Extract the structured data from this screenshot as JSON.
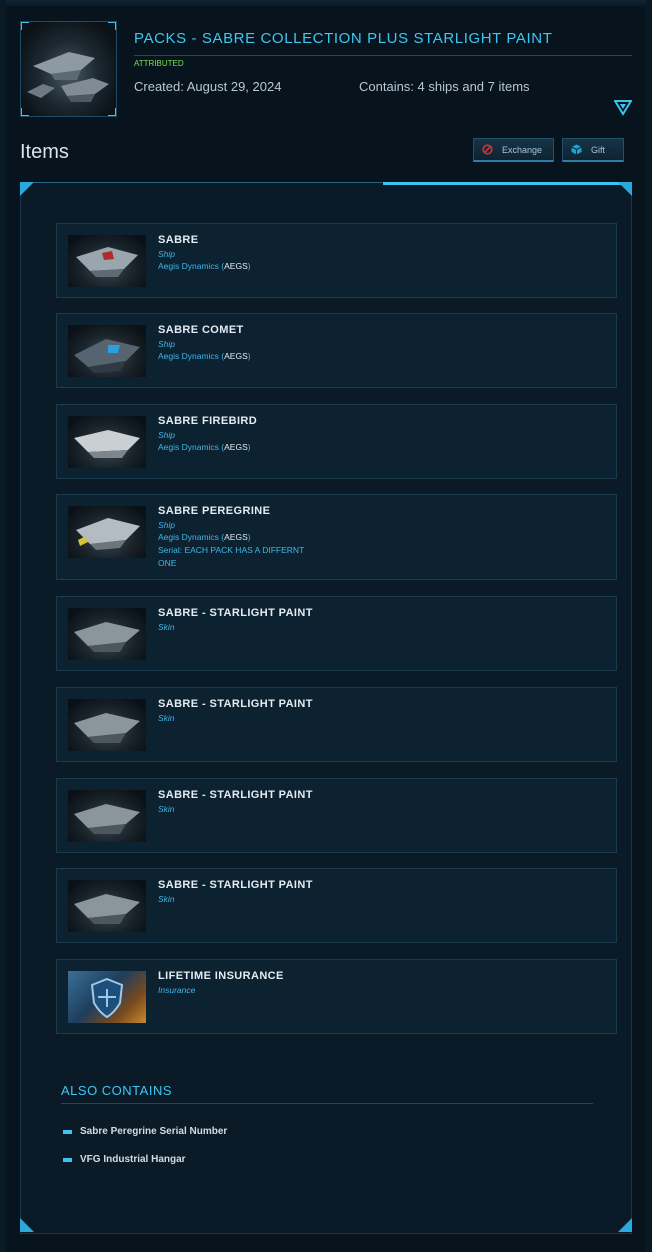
{
  "pack": {
    "title": "PACKS - SABRE COLLECTION PLUS STARLIGHT PAINT",
    "status": "ATTRIBUTED",
    "created": "Created: August 29, 2024",
    "contains": "Contains: 4 ships and 7 items"
  },
  "items_section": {
    "heading": "Items",
    "exchange_label": "Exchange",
    "gift_label": "Gift"
  },
  "items": [
    {
      "name": "SABRE",
      "type": "Ship",
      "manufacturer": "Aegis Dynamics",
      "code": "AEGS"
    },
    {
      "name": "SABRE COMET",
      "type": "Ship",
      "manufacturer": "Aegis Dynamics",
      "code": "AEGS"
    },
    {
      "name": "SABRE FIREBIRD",
      "type": "Ship",
      "manufacturer": "Aegis Dynamics",
      "code": "AEGS"
    },
    {
      "name": "SABRE PEREGRINE",
      "type": "Ship",
      "manufacturer": "Aegis Dynamics",
      "code": "AEGS",
      "serial": "Serial: EACH PACK HAS A DIFFERNT ONE"
    },
    {
      "name": "SABRE - STARLIGHT PAINT",
      "type": "Skin"
    },
    {
      "name": "SABRE - STARLIGHT PAINT",
      "type": "Skin"
    },
    {
      "name": "SABRE - STARLIGHT PAINT",
      "type": "Skin"
    },
    {
      "name": "SABRE - STARLIGHT PAINT",
      "type": "Skin"
    },
    {
      "name": "LIFETIME INSURANCE",
      "type": "Insurance"
    }
  ],
  "also_contains": {
    "heading": "ALSO CONTAINS",
    "entries": [
      "Sabre Peregrine Serial Number",
      "VFG Industrial Hangar"
    ]
  },
  "colors": {
    "accent": "#3fc6f2",
    "status_green": "#6ee84a",
    "background": "#07131d",
    "exchange_icon": "#e02b2b"
  },
  "icons": [
    "expand-chevron-icon",
    "exchange-icon",
    "gift-icon"
  ]
}
